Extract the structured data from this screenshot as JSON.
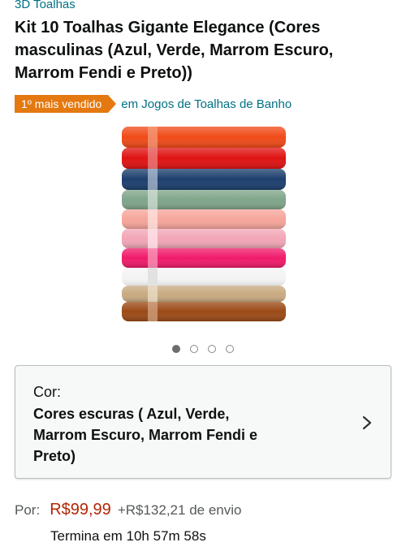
{
  "brand": "3D Toalhas",
  "title": "Kit 10 Toalhas Gigante Elegance (Cores masculinas (Azul, Verde, Marrom Escuro, Marrom Fendi e Preto))",
  "badge": {
    "label": "1º mais vendido",
    "category_prefix": "em",
    "category": "Jogos de Toalhas de Banho",
    "color": "#e47911"
  },
  "image": {
    "icon": "towel-stack-image",
    "dots_count": 4,
    "active_index": 0
  },
  "variant": {
    "label": "Cor:",
    "value": "Cores escuras ( Azul, Verde, Marrom Escuro, Marrom Fendi e Preto)",
    "icon": "chevron-right-icon"
  },
  "price": {
    "prefix": "Por:",
    "amount": "R$99,99",
    "shipping": "+R$132,21 de envio",
    "color": "#b12704"
  },
  "deal_timer": "Termina em 10h 57m 58s"
}
